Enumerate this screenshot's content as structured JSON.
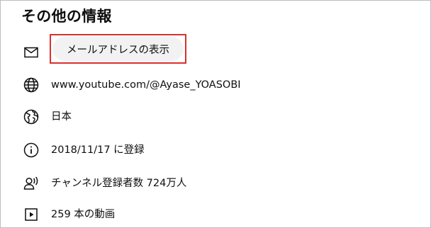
{
  "title": "その他の情報",
  "email_button": {
    "label": "メールアドレスの表示"
  },
  "rows": [
    {
      "icon": "mail-icon",
      "text": ""
    },
    {
      "icon": "globe-icon",
      "text": "www.youtube.com/@Ayase_YOASOBI"
    },
    {
      "icon": "world-map-icon",
      "text": "日本"
    },
    {
      "icon": "info-icon",
      "text": "2018/11/17 に登録"
    },
    {
      "icon": "subscribers-icon",
      "text": "チャンネル登録者数 724万人"
    },
    {
      "icon": "play-video-icon",
      "text": "259 本の動画"
    }
  ],
  "colors": {
    "highlight_border": "#d9302f",
    "button_bg": "#f2f2f2",
    "text": "#0f0f0f"
  }
}
